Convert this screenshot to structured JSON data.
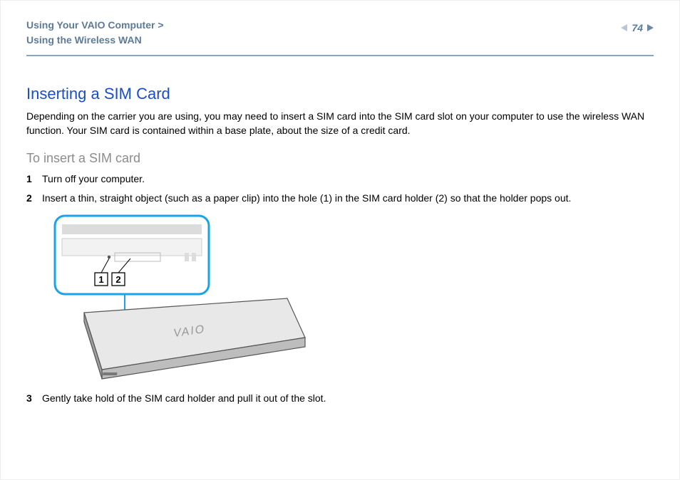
{
  "header": {
    "breadcrumb_line1": "Using Your VAIO Computer >",
    "breadcrumb_line2": "Using the Wireless WAN",
    "page_number": "74"
  },
  "section": {
    "title": "Inserting a SIM Card",
    "intro": "Depending on the carrier you are using, you may need to insert a SIM card into the SIM card slot on your computer to use the wireless WAN function. Your SIM card is contained within a base plate, about the size of a credit card.",
    "subtitle": "To insert a SIM card",
    "steps": [
      "Turn off your computer.",
      "Insert a thin, straight object (such as a paper clip) into the hole (1) in the SIM card holder (2) so that the holder pops out.",
      "Gently take hold of the SIM card holder and pull it out of the slot."
    ]
  },
  "figure": {
    "callout_labels": [
      "1",
      "2"
    ],
    "laptop_brand_text": "VAIO"
  }
}
